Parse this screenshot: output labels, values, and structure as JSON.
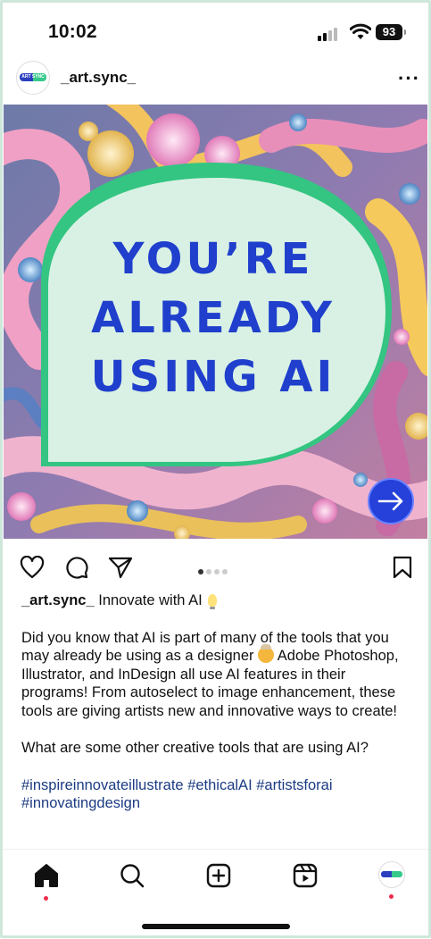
{
  "status_bar": {
    "time": "10:02",
    "battery": "93"
  },
  "post": {
    "username": "_art.sync_",
    "avatar_text": "ART SYNC",
    "image_headline_lines": [
      "YOU’RE",
      "ALREADY",
      "USING AI"
    ],
    "carousel": {
      "total": 4,
      "active_index": 0
    }
  },
  "caption": {
    "username": "_art.sync_",
    "title": "Innovate with AI",
    "para1_a": "Did you know that AI is part of many of the tools that you may already be using as a designer",
    "para1_b": " Adobe Photoshop, Illustrator, and InDesign all use AI features in their programs! From autoselect to image enhancement, these tools are giving artists new and innovative ways to create!",
    "para2": "What are some other creative tools that are using AI?",
    "hashtags": "#inspireinnovateillustrate #ethicalAI #artistsforai #innovatingdesign"
  },
  "icons": {
    "header_more": "more-horizontal-icon",
    "actions": [
      "heart-icon",
      "comment-icon",
      "share-icon",
      "bookmark-icon"
    ],
    "tabs": [
      "home-icon",
      "search-icon",
      "create-icon",
      "reels-icon",
      "profile-avatar"
    ]
  },
  "colors": {
    "headline": "#1f3fcc",
    "bubble": "#d9f1e4",
    "bubble_border": "#33c581",
    "hashtag": "#1b3b83",
    "next_button": "#2541d9",
    "notification_dot": "#ef2b4a"
  }
}
